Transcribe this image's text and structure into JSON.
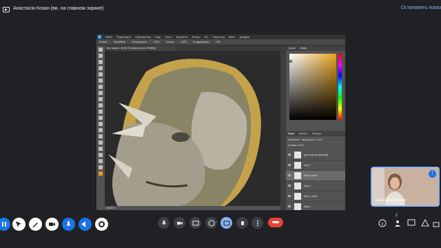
{
  "meet": {
    "presenter_banner": "Анастасія Кохан (ви, на главном экране)",
    "stop_presenting": "Остановить показ",
    "self_view_name": "Анастасія Кохан",
    "participants_count": "2"
  },
  "photoshop": {
    "menu": [
      "Файл",
      "Редагувати",
      "Зображення",
      "Шар",
      "Текст",
      "Виділити",
      "Фільтр",
      "3D",
      "Перегляд",
      "Вікно",
      "Довідка"
    ],
    "options": [
      "Режим:",
      "Звичайний",
      "Непрозорість:",
      "100%",
      "Натиск:",
      "100%",
      "Згладжування:",
      "10%"
    ],
    "doc_tab": "Без назви-1 @ 66,7% (Шар 6 копія, RGB/8#)",
    "status": "66,67%",
    "color_tabs": [
      "Зразки",
      "Колір"
    ],
    "layers_tabs": [
      "Шари",
      "Канали",
      "Контури"
    ],
    "blend_mode": "Звичайний",
    "opacity_label": "Непрозорість: 100%",
    "fill_label": "Заливка: 100%",
    "layers": [
      {
        "name": "дополнение цветовой",
        "selected": false
      },
      {
        "name": "Шар 7",
        "selected": false
      },
      {
        "name": "Шар 6 копія",
        "selected": true
      },
      {
        "name": "Шар 6",
        "selected": false
      },
      {
        "name": "Шар 1 копія",
        "selected": false
      },
      {
        "name": "Шар 1",
        "selected": false
      }
    ]
  },
  "colors": {
    "accent": "#1a73e8",
    "end_call": "#ea4335",
    "background": "#202124",
    "foreground_color": "#e8a31e"
  }
}
